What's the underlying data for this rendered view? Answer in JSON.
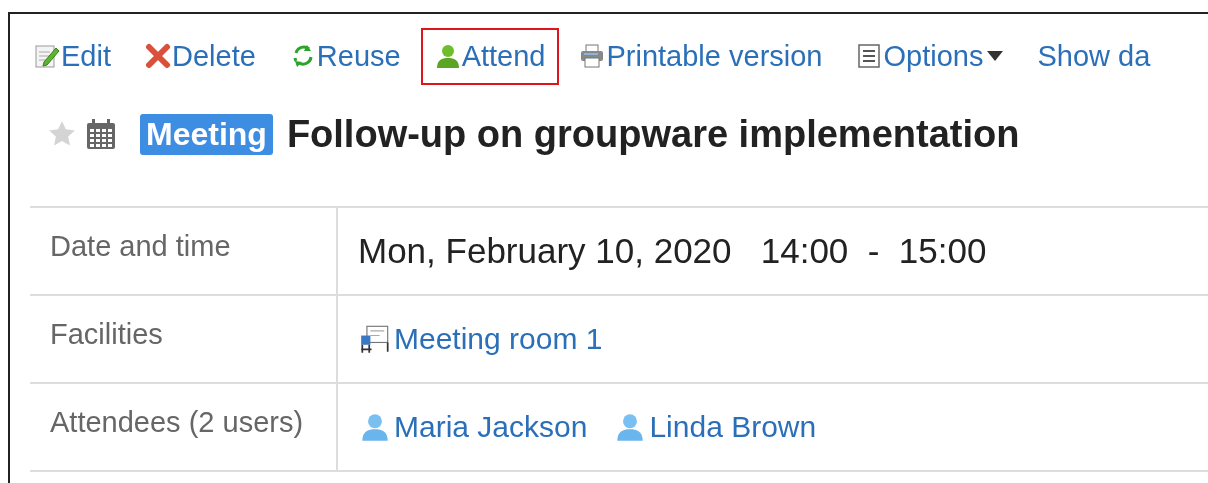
{
  "toolbar": [
    {
      "kind": "edit",
      "label": "Edit",
      "highlighted": false
    },
    {
      "kind": "delete",
      "label": "Delete",
      "highlighted": false
    },
    {
      "kind": "reuse",
      "label": "Reuse",
      "highlighted": false
    },
    {
      "kind": "attend",
      "label": "Attend",
      "highlighted": true
    },
    {
      "kind": "print",
      "label": "Printable version",
      "highlighted": false
    },
    {
      "kind": "options",
      "label": "Options",
      "highlighted": false
    },
    {
      "kind": "plain",
      "label": "Show da",
      "highlighted": false
    }
  ],
  "header": {
    "starred": false,
    "tag": "Meeting",
    "title": "Follow-up on groupware implementation"
  },
  "details": [
    {
      "kind": "text",
      "label": "Date and time",
      "value": "Mon, February 10, 2020   14:00  -  15:00"
    },
    {
      "kind": "links",
      "label": "Facilities",
      "links": [
        {
          "kind": "facility",
          "text": "Meeting room 1"
        }
      ]
    },
    {
      "kind": "links",
      "label": "Attendees (2 users)",
      "links": [
        {
          "kind": "user",
          "text": "Maria Jackson"
        },
        {
          "kind": "user",
          "text": "Linda Brown"
        }
      ]
    }
  ]
}
